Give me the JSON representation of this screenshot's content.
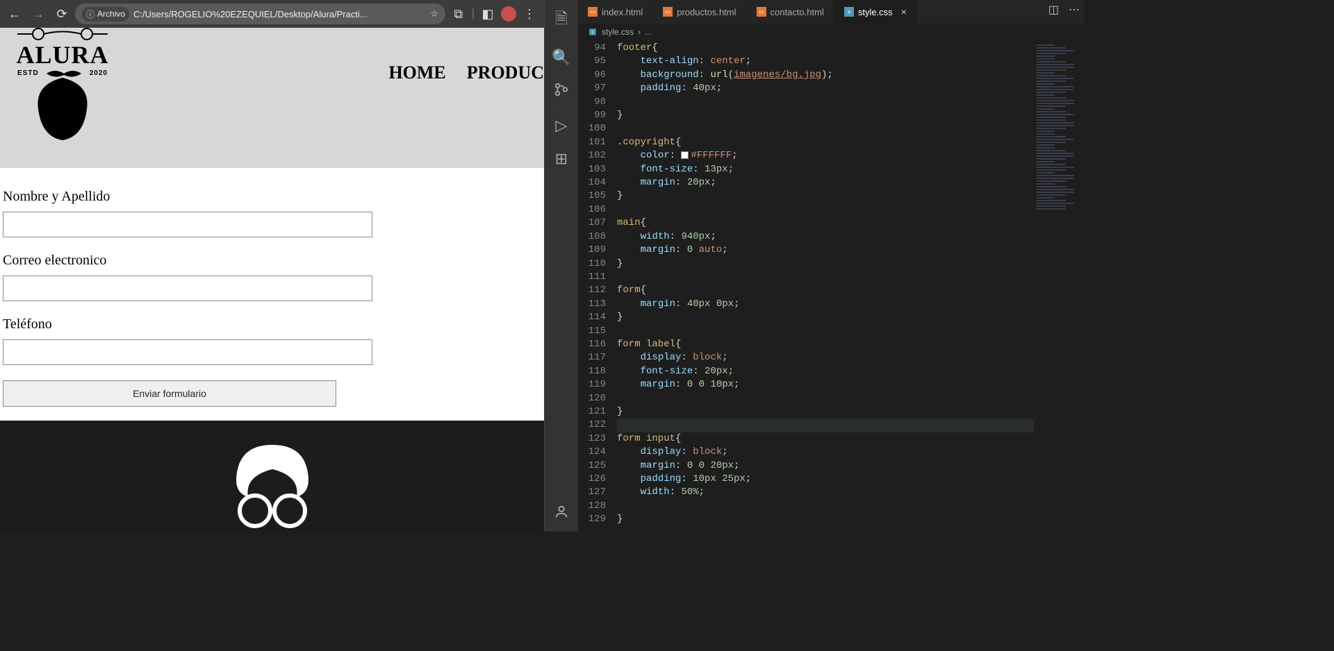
{
  "browser": {
    "addr_label": "Archivo",
    "url": "C:/Users/ROGELIO%20EZEQUIEL/Desktop/Alura/Practi...",
    "logo_text": "ALURA",
    "logo_estd": "ESTD",
    "logo_year": "2020",
    "nav": {
      "home": "HOME",
      "productos": "PRODUC"
    },
    "form": {
      "nombre": "Nombre y Apellido",
      "correo": "Correo electronico",
      "telefono": "Teléfono",
      "submit": "Enviar formulario"
    }
  },
  "vscode": {
    "tabs": [
      {
        "name": "index.html",
        "icon": "html"
      },
      {
        "name": "productos.html",
        "icon": "html"
      },
      {
        "name": "contacto.html",
        "icon": "html"
      },
      {
        "name": "style.css",
        "icon": "css",
        "active": true
      }
    ],
    "breadcrumb": {
      "file": "style.css",
      "sep": "›",
      "more": "..."
    },
    "first_line": 94,
    "lines": [
      [
        {
          "t": "footer",
          "c": "tok-sel"
        },
        {
          "t": "{",
          "c": "tok-punc"
        }
      ],
      [
        {
          "t": "    "
        },
        {
          "t": "text-align",
          "c": "tok-prop"
        },
        {
          "t": ": ",
          "c": "tok-punc"
        },
        {
          "t": "center",
          "c": "tok-val"
        },
        {
          "t": ";",
          "c": "tok-punc"
        }
      ],
      [
        {
          "t": "    "
        },
        {
          "t": "background",
          "c": "tok-prop"
        },
        {
          "t": ": ",
          "c": "tok-punc"
        },
        {
          "t": "url",
          "c": "tok-fn"
        },
        {
          "t": "(",
          "c": "tok-punc"
        },
        {
          "t": "imagenes/bg.jpg",
          "c": "tok-url"
        },
        {
          "t": ");",
          "c": "tok-punc"
        }
      ],
      [
        {
          "t": "    "
        },
        {
          "t": "padding",
          "c": "tok-prop"
        },
        {
          "t": ": ",
          "c": "tok-punc"
        },
        {
          "t": "40px",
          "c": "tok-num"
        },
        {
          "t": ";",
          "c": "tok-punc"
        }
      ],
      [],
      [
        {
          "t": "}",
          "c": "tok-punc"
        }
      ],
      [],
      [
        {
          "t": ".copyright",
          "c": "tok-sel"
        },
        {
          "t": "{",
          "c": "tok-punc"
        }
      ],
      [
        {
          "t": "    "
        },
        {
          "t": "color",
          "c": "tok-prop"
        },
        {
          "t": ": ",
          "c": "tok-punc"
        },
        {
          "swatch": true
        },
        {
          "t": "#FFFFFF",
          "c": "tok-val"
        },
        {
          "t": ";",
          "c": "tok-punc"
        }
      ],
      [
        {
          "t": "    "
        },
        {
          "t": "font-size",
          "c": "tok-prop"
        },
        {
          "t": ": ",
          "c": "tok-punc"
        },
        {
          "t": "13px",
          "c": "tok-num"
        },
        {
          "t": ";",
          "c": "tok-punc"
        }
      ],
      [
        {
          "t": "    "
        },
        {
          "t": "margin",
          "c": "tok-prop"
        },
        {
          "t": ": ",
          "c": "tok-punc"
        },
        {
          "t": "20px",
          "c": "tok-num"
        },
        {
          "t": ";",
          "c": "tok-punc"
        }
      ],
      [
        {
          "t": "}",
          "c": "tok-punc"
        }
      ],
      [],
      [
        {
          "t": "main",
          "c": "tok-sel"
        },
        {
          "t": "{",
          "c": "tok-punc"
        }
      ],
      [
        {
          "t": "    "
        },
        {
          "t": "width",
          "c": "tok-prop"
        },
        {
          "t": ": ",
          "c": "tok-punc"
        },
        {
          "t": "940px",
          "c": "tok-num"
        },
        {
          "t": ";",
          "c": "tok-punc"
        }
      ],
      [
        {
          "t": "    "
        },
        {
          "t": "margin",
          "c": "tok-prop"
        },
        {
          "t": ": ",
          "c": "tok-punc"
        },
        {
          "t": "0",
          "c": "tok-num"
        },
        {
          "t": " "
        },
        {
          "t": "auto",
          "c": "tok-val"
        },
        {
          "t": ";",
          "c": "tok-punc"
        }
      ],
      [
        {
          "t": "}",
          "c": "tok-punc"
        }
      ],
      [],
      [
        {
          "t": "form",
          "c": "tok-sel"
        },
        {
          "t": "{",
          "c": "tok-punc"
        }
      ],
      [
        {
          "t": "    "
        },
        {
          "t": "margin",
          "c": "tok-prop"
        },
        {
          "t": ": ",
          "c": "tok-punc"
        },
        {
          "t": "40px",
          "c": "tok-num"
        },
        {
          "t": " "
        },
        {
          "t": "0px",
          "c": "tok-num"
        },
        {
          "t": ";",
          "c": "tok-punc"
        }
      ],
      [
        {
          "t": "}",
          "c": "tok-punc"
        }
      ],
      [],
      [
        {
          "t": "form label",
          "c": "tok-sel"
        },
        {
          "t": "{",
          "c": "tok-punc"
        }
      ],
      [
        {
          "t": "    "
        },
        {
          "t": "display",
          "c": "tok-prop"
        },
        {
          "t": ": ",
          "c": "tok-punc"
        },
        {
          "t": "block",
          "c": "tok-val"
        },
        {
          "t": ";",
          "c": "tok-punc"
        }
      ],
      [
        {
          "t": "    "
        },
        {
          "t": "font-size",
          "c": "tok-prop"
        },
        {
          "t": ": ",
          "c": "tok-punc"
        },
        {
          "t": "20px",
          "c": "tok-num"
        },
        {
          "t": ";",
          "c": "tok-punc"
        }
      ],
      [
        {
          "t": "    "
        },
        {
          "t": "margin",
          "c": "tok-prop"
        },
        {
          "t": ": ",
          "c": "tok-punc"
        },
        {
          "t": "0",
          "c": "tok-num"
        },
        {
          "t": " "
        },
        {
          "t": "0",
          "c": "tok-num"
        },
        {
          "t": " "
        },
        {
          "t": "10px",
          "c": "tok-num"
        },
        {
          "t": ";",
          "c": "tok-punc"
        }
      ],
      [],
      [
        {
          "t": "}",
          "c": "tok-punc"
        }
      ],
      [],
      [
        {
          "t": "form input",
          "c": "tok-sel"
        },
        {
          "t": "{",
          "c": "tok-punc"
        }
      ],
      [
        {
          "t": "    "
        },
        {
          "t": "display",
          "c": "tok-prop"
        },
        {
          "t": ": ",
          "c": "tok-punc"
        },
        {
          "t": "block",
          "c": "tok-val"
        },
        {
          "t": ";",
          "c": "tok-punc"
        }
      ],
      [
        {
          "t": "    "
        },
        {
          "t": "margin",
          "c": "tok-prop"
        },
        {
          "t": ": ",
          "c": "tok-punc"
        },
        {
          "t": "0",
          "c": "tok-num"
        },
        {
          "t": " "
        },
        {
          "t": "0",
          "c": "tok-num"
        },
        {
          "t": " "
        },
        {
          "t": "20px",
          "c": "tok-num"
        },
        {
          "t": ";",
          "c": "tok-punc"
        }
      ],
      [
        {
          "t": "    "
        },
        {
          "t": "padding",
          "c": "tok-prop"
        },
        {
          "t": ": ",
          "c": "tok-punc"
        },
        {
          "t": "10px",
          "c": "tok-num"
        },
        {
          "t": " "
        },
        {
          "t": "25px",
          "c": "tok-num"
        },
        {
          "t": ";",
          "c": "tok-punc"
        }
      ],
      [
        {
          "t": "    "
        },
        {
          "t": "width",
          "c": "tok-prop"
        },
        {
          "t": ": ",
          "c": "tok-punc"
        },
        {
          "t": "50%",
          "c": "tok-num"
        },
        {
          "t": ";",
          "c": "tok-punc"
        }
      ],
      [],
      [
        {
          "t": "}",
          "c": "tok-punc"
        }
      ]
    ],
    "highlight_index": 28
  }
}
